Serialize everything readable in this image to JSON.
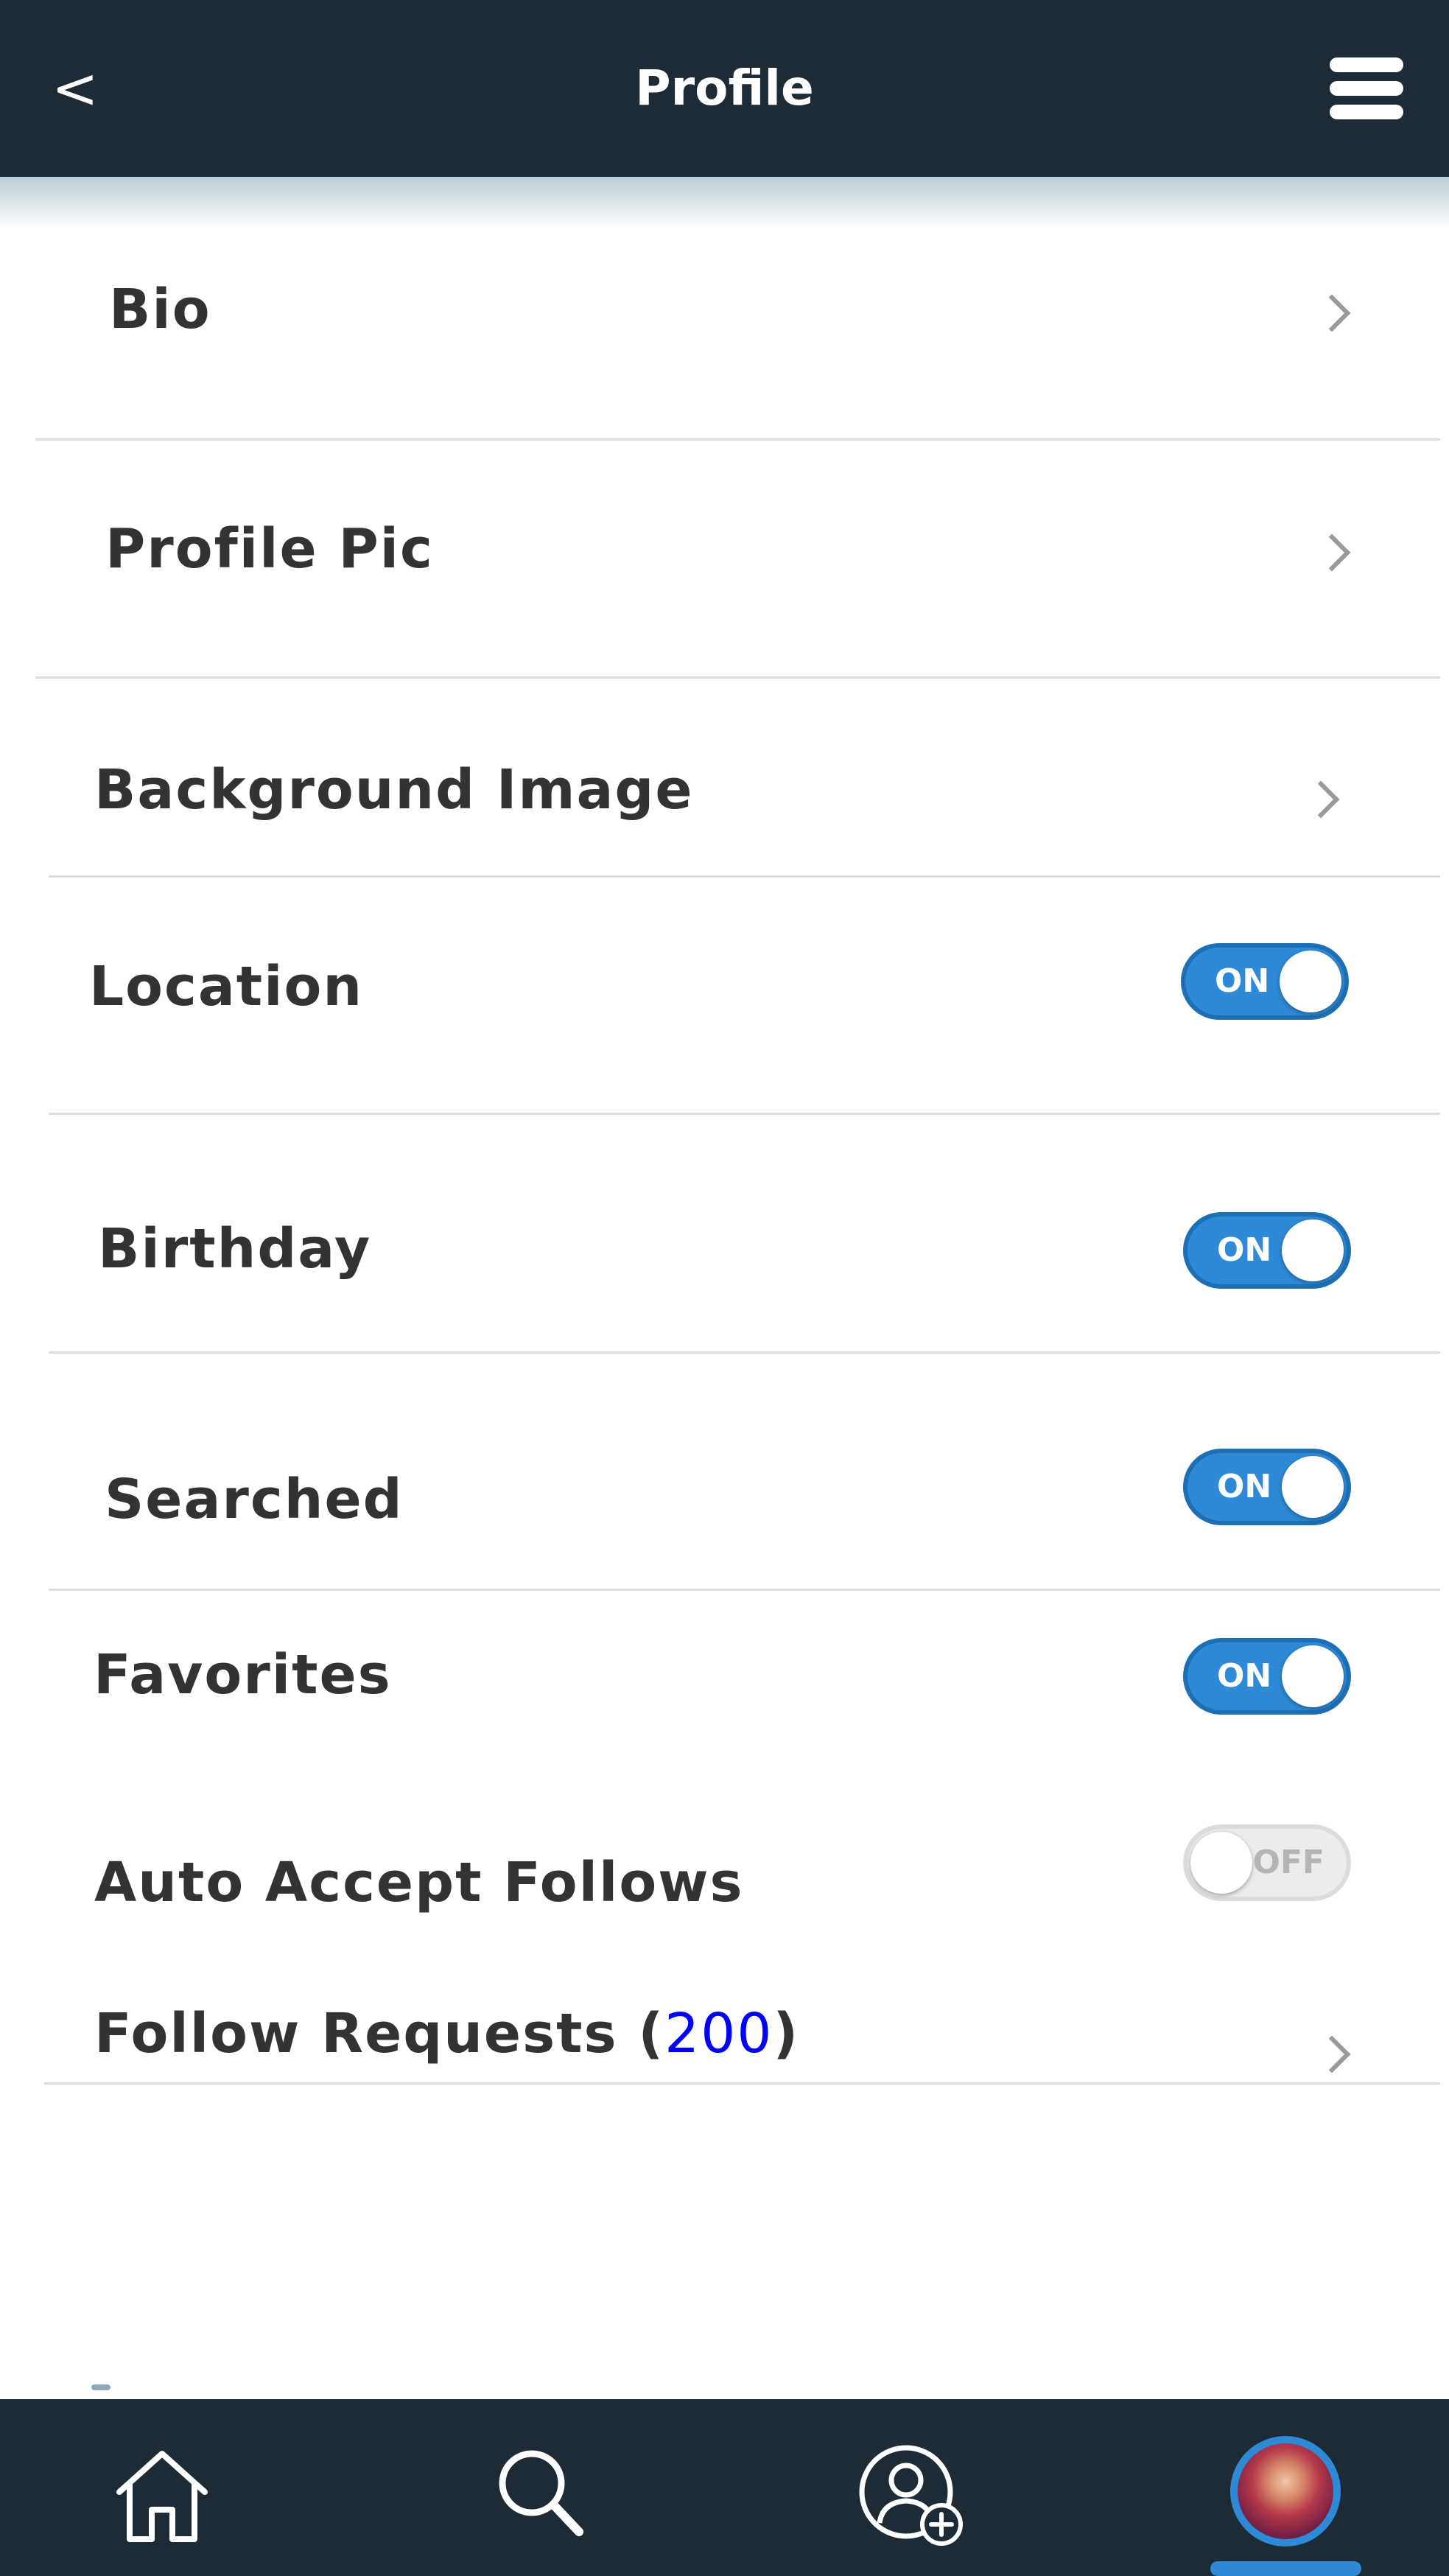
{
  "header": {
    "back_label": "<",
    "title": "Profile"
  },
  "settings": {
    "bio": {
      "label": "Bio"
    },
    "profile_pic": {
      "label": "Profile Pic"
    },
    "background_image": {
      "label": "Background Image"
    },
    "location": {
      "label": "Location",
      "toggle": "ON"
    },
    "birthday": {
      "label": "Birthday",
      "toggle": "ON"
    },
    "searched": {
      "label": "Searched",
      "toggle": "ON"
    },
    "favorites": {
      "label": "Favorites",
      "toggle": "ON"
    },
    "auto_accept_follows": {
      "label": "Auto Accept Follows",
      "toggle": "OFF"
    },
    "follow_requests": {
      "label_prefix": "Follow Requests (",
      "count": "200",
      "label_suffix": ")"
    }
  },
  "bottom_nav": {
    "items": [
      "home",
      "search",
      "add-friend",
      "profile"
    ],
    "active": "profile"
  },
  "colors": {
    "bar_background": "#1c2b36",
    "accent_blue": "#2e8ad6",
    "count_blue": "#0000ff"
  }
}
